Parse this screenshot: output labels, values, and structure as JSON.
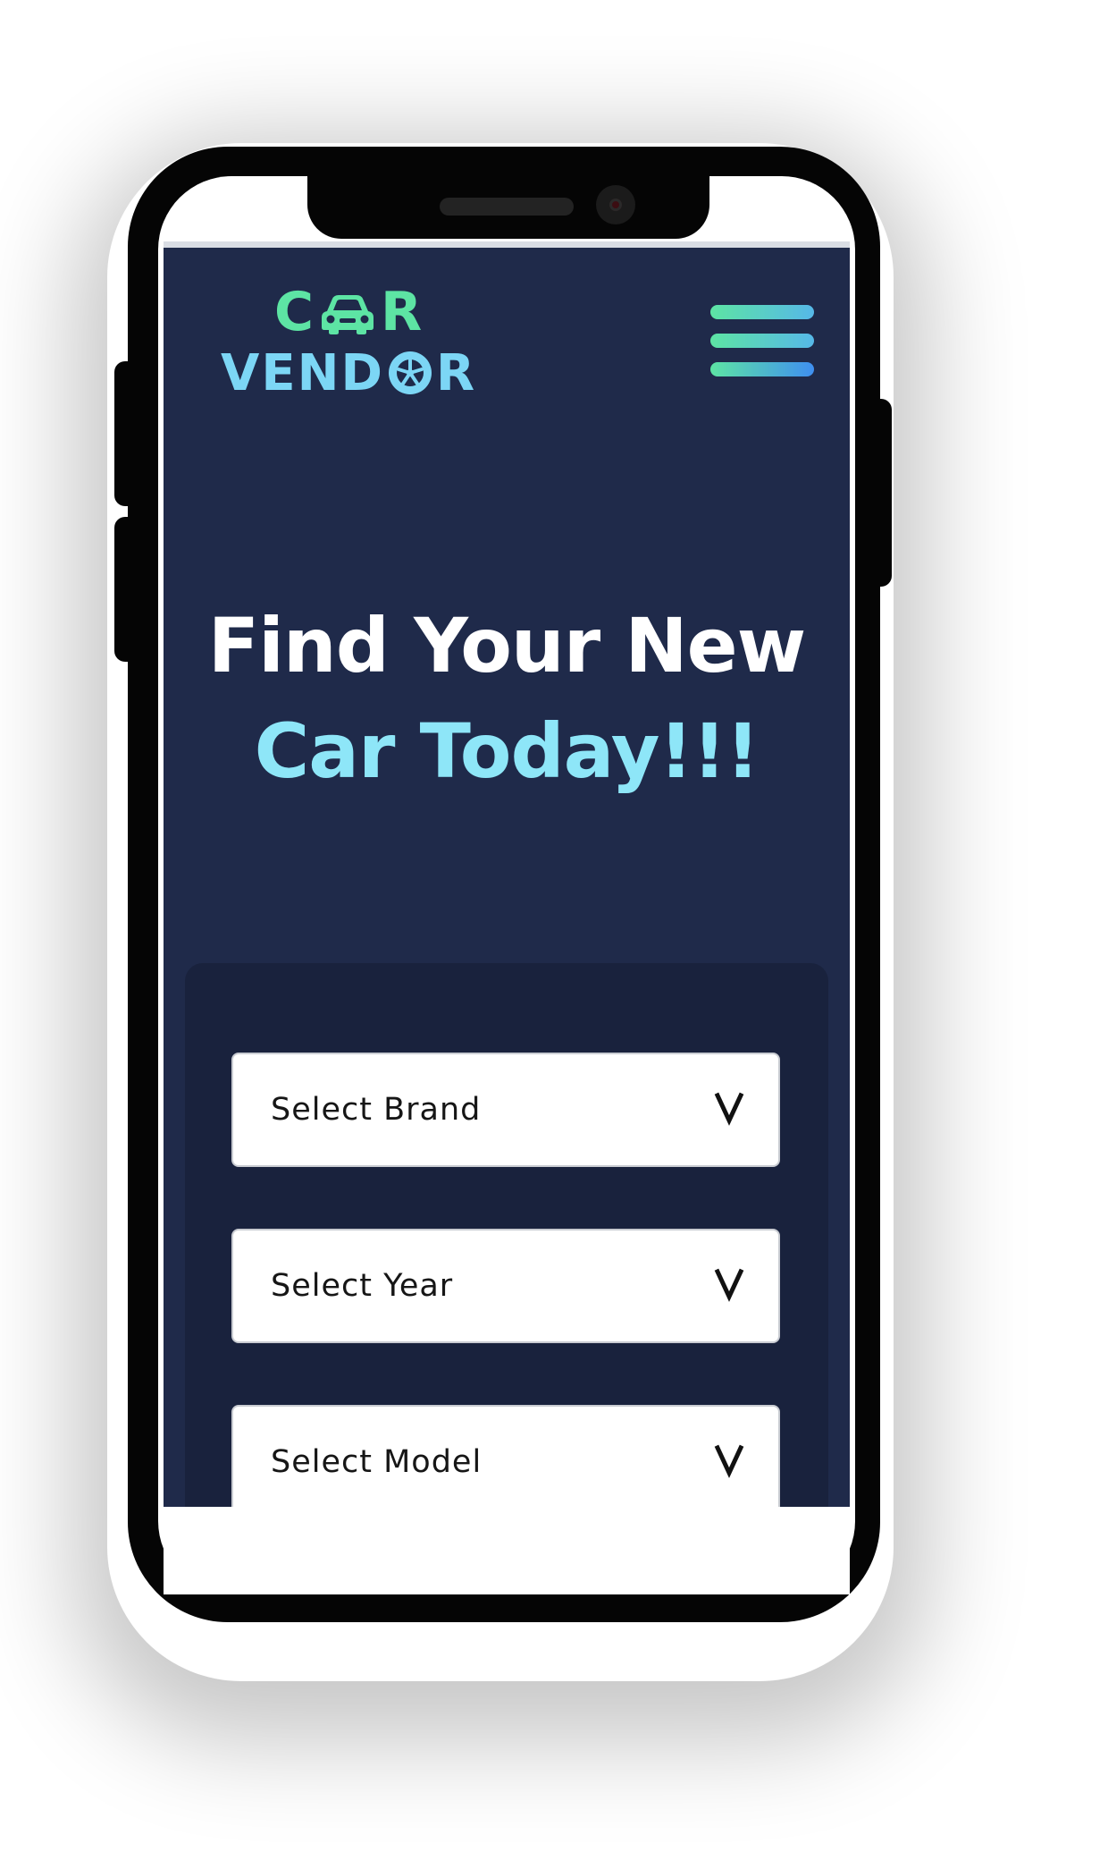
{
  "brand": {
    "logo_line1_left": "C",
    "logo_line1_right": "R",
    "logo_line2_left": "VEND",
    "logo_line2_right": "R",
    "logo_icon_top": "car-icon",
    "logo_icon_bottom": "wheel-icon",
    "colors": {
      "logo_green": "#5de4a4",
      "logo_blue": "#7cd6f5",
      "hero_accent": "#8ee6f8",
      "app_background": "#1f2a4a",
      "panel_background": "#19223d"
    }
  },
  "nav": {
    "menu_icon": "hamburger-menu-icon"
  },
  "hero": {
    "line1": "Find Your New",
    "line2": "Car Today!!!"
  },
  "search": {
    "brand_select": "Select Brand",
    "year_select": "Select Year",
    "model_select": "Select Model",
    "chevron_icon": "chevron-down-icon"
  }
}
